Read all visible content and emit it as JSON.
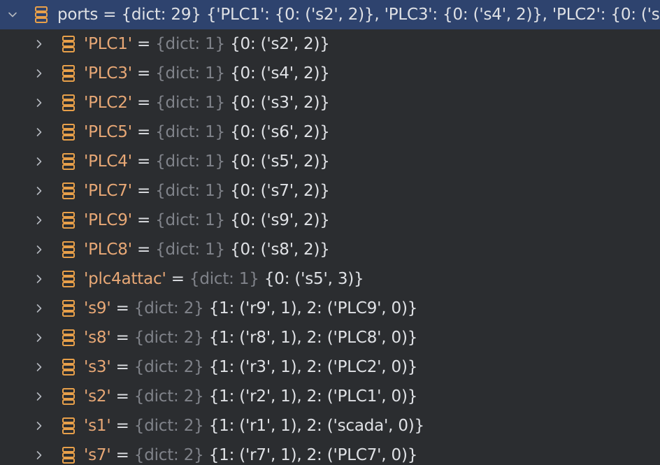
{
  "root": {
    "name": "ports",
    "separator": " = ",
    "type_label": "{dict: 29}",
    "value_preview": "{'PLC1': {0: ('s2', 2)}, 'PLC3': {0: ('s4', 2)}, 'PLC2': {0: ('s"
  },
  "items": [
    {
      "key": "'PLC1'",
      "type_label": "{dict: 1}",
      "value": "{0: ('s2', 2)}"
    },
    {
      "key": "'PLC3'",
      "type_label": "{dict: 1}",
      "value": "{0: ('s4', 2)}"
    },
    {
      "key": "'PLC2'",
      "type_label": "{dict: 1}",
      "value": "{0: ('s3', 2)}"
    },
    {
      "key": "'PLC5'",
      "type_label": "{dict: 1}",
      "value": "{0: ('s6', 2)}"
    },
    {
      "key": "'PLC4'",
      "type_label": "{dict: 1}",
      "value": "{0: ('s5', 2)}"
    },
    {
      "key": "'PLC7'",
      "type_label": "{dict: 1}",
      "value": "{0: ('s7', 2)}"
    },
    {
      "key": "'PLC9'",
      "type_label": "{dict: 1}",
      "value": "{0: ('s9', 2)}"
    },
    {
      "key": "'PLC8'",
      "type_label": "{dict: 1}",
      "value": "{0: ('s8', 2)}"
    },
    {
      "key": "'plc4attac'",
      "type_label": "{dict: 1}",
      "value": "{0: ('s5', 3)}"
    },
    {
      "key": "'s9'",
      "type_label": "{dict: 2}",
      "value": "{1: ('r9', 1), 2: ('PLC9', 0)}"
    },
    {
      "key": "'s8'",
      "type_label": "{dict: 2}",
      "value": "{1: ('r8', 1), 2: ('PLC8', 0)}"
    },
    {
      "key": "'s3'",
      "type_label": "{dict: 2}",
      "value": "{1: ('r3', 1), 2: ('PLC2', 0)}"
    },
    {
      "key": "'s2'",
      "type_label": "{dict: 2}",
      "value": "{1: ('r2', 1), 2: ('PLC1', 0)}"
    },
    {
      "key": "'s1'",
      "type_label": "{dict: 2}",
      "value": "{1: ('r1', 1), 2: ('scada', 0)}"
    },
    {
      "key": "'s7'",
      "type_label": "{dict: 2}",
      "value": "{1: ('r7', 1), 2: ('PLC7', 0)}"
    }
  ],
  "item_separator": " = ",
  "icons": {
    "expanded": "chevron-down-icon",
    "collapsed": "chevron-right-icon",
    "dict": "dict-icon"
  },
  "colors": {
    "background": "#2b2d30",
    "selection": "#2e436e",
    "key": "#e8a876",
    "type": "#80838a",
    "text": "#dfe1e5",
    "icon": "#e8a04a"
  }
}
